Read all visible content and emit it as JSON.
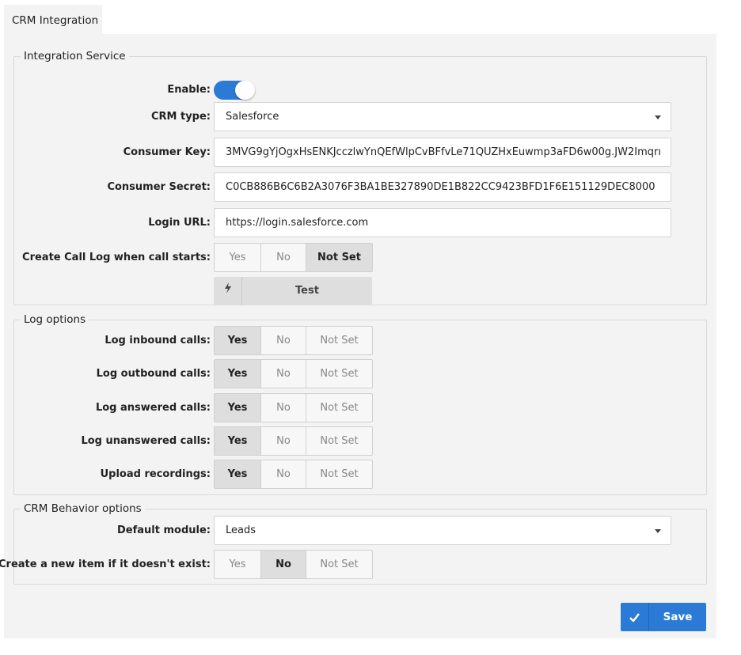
{
  "tab": {
    "label": "CRM Integration"
  },
  "integration": {
    "legend": "Integration Service",
    "enable_label": "Enable:",
    "enabled": true,
    "crm_type_label": "CRM type:",
    "crm_type_value": "Salesforce",
    "consumer_key_label": "Consumer Key:",
    "consumer_key_value": "3MVG9gYjOgxHsENKJcczlwYnQEfWlpCvBFfvLe71QUZHxEuwmp3aFD6w00g.JW2Imqrı",
    "consumer_secret_label": "Consumer Secret:",
    "consumer_secret_value": "C0CB886B6C6B2A3076F3BA1BE327890DE1B822CC9423BFD1F6E151129DEC8000",
    "login_url_label": "Login URL:",
    "login_url_value": "https://login.salesforce.com",
    "call_log_label": "Create Call Log when call starts:",
    "call_log_selected": "Not Set",
    "test_label": "Test",
    "test_icon": "bolt-icon"
  },
  "options": {
    "yes": "Yes",
    "no": "No",
    "not_set": "Not Set"
  },
  "log": {
    "legend": "Log options",
    "rows": [
      {
        "label": "Log inbound calls:",
        "selected": "Yes"
      },
      {
        "label": "Log outbound calls:",
        "selected": "Yes"
      },
      {
        "label": "Log answered calls:",
        "selected": "Yes"
      },
      {
        "label": "Log unanswered calls:",
        "selected": "Yes"
      },
      {
        "label": "Upload recordings:",
        "selected": "Yes"
      }
    ]
  },
  "crm": {
    "legend": "CRM Behavior options",
    "default_module_label": "Default module:",
    "default_module_value": "Leads",
    "create_item_label": "Create a new item if it doesn't exist:",
    "create_item_selected": "No"
  },
  "save": {
    "label": "Save",
    "icon": "check-icon"
  },
  "colors": {
    "accent": "#2b7bd6",
    "panel_bg": "#f3f3f3",
    "active_seg": "#dedede"
  }
}
